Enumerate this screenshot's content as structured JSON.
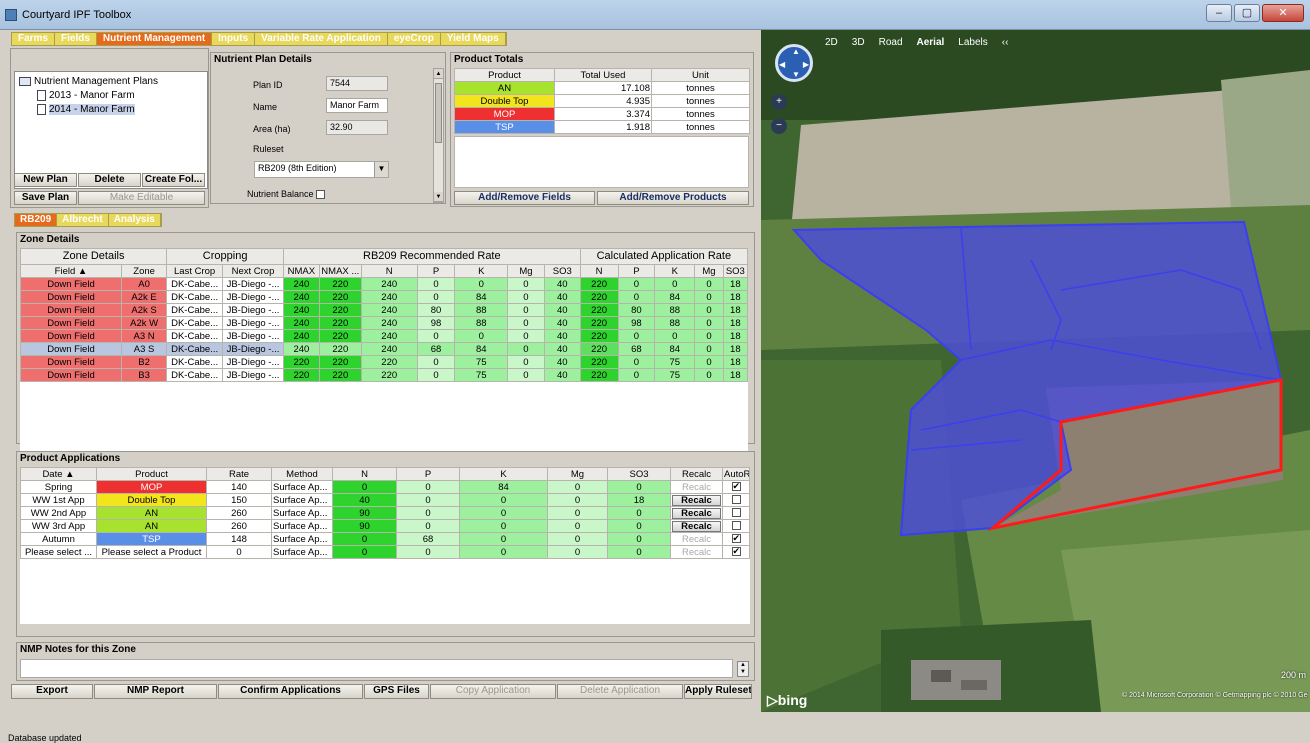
{
  "window": {
    "title": "Courtyard IPF Toolbox",
    "min": "–",
    "max": "▢",
    "close": "✕"
  },
  "main_tabs": [
    "Farms",
    "Fields",
    "Nutrient Management",
    "Inputs",
    "Variable Rate Application",
    "eyeCrop",
    "Yield Maps"
  ],
  "main_tab_active": 2,
  "tree": {
    "root": "Nutrient Management Plans",
    "items": [
      "2013 - Manor Farm",
      "2014 - Manor Farm"
    ]
  },
  "plan_buttons": {
    "new": "New Plan",
    "delete": "Delete",
    "create": "Create Fol...",
    "save": "Save Plan",
    "editable": "Make Editable"
  },
  "plan_details": {
    "title": "Nutrient Plan Details",
    "plan_id_label": "Plan ID",
    "plan_id": "7544",
    "name_label": "Name",
    "name": "Manor Farm",
    "area_label": "Area (ha)",
    "area": "32.90",
    "ruleset_label": "Ruleset",
    "ruleset": "RB209 (8th Edition)",
    "balance_label": "Nutrient Balance"
  },
  "product_totals": {
    "title": "Product Totals",
    "headers": [
      "Product",
      "Total Used",
      "Unit"
    ],
    "rows": [
      {
        "product": "AN",
        "total": "17.108",
        "unit": "tonnes",
        "color": "#a6e22e"
      },
      {
        "product": "Double Top",
        "total": "4.935",
        "unit": "tonnes",
        "color": "#f2e51c"
      },
      {
        "product": "MOP",
        "total": "3.374",
        "unit": "tonnes",
        "color": "#ee3030"
      },
      {
        "product": "TSP",
        "total": "1.918",
        "unit": "tonnes",
        "color": "#5a8fe8"
      }
    ],
    "add_fields": "Add/Remove Fields",
    "add_products": "Add/Remove Products"
  },
  "sub_tabs": [
    "RB209",
    "Albrecht",
    "Analysis"
  ],
  "zone_details": {
    "title": "Zone Details",
    "groups": [
      "Zone Details",
      "Cropping",
      "RB209 Recommended Rate",
      "Calculated Application Rate"
    ],
    "headers": [
      "Field ▲",
      "Zone",
      "Last Crop",
      "Next Crop",
      "NMAX",
      "NMAX ...",
      "N",
      "P",
      "K",
      "Mg",
      "SO3",
      "N",
      "P",
      "K",
      "Mg",
      "SO3"
    ],
    "rows": [
      {
        "c": [
          "Down Field",
          "A0",
          "DK-Cabe...",
          "JB-Diego -...",
          "240",
          "220",
          "240",
          "0",
          "0",
          "0",
          "40",
          "220",
          "0",
          "0",
          "0",
          "18"
        ],
        "sel": false
      },
      {
        "c": [
          "Down Field",
          "A2k E",
          "DK-Cabe...",
          "JB-Diego -...",
          "240",
          "220",
          "240",
          "0",
          "84",
          "0",
          "40",
          "220",
          "0",
          "84",
          "0",
          "18"
        ],
        "sel": false
      },
      {
        "c": [
          "Down Field",
          "A2k S",
          "DK-Cabe...",
          "JB-Diego -...",
          "240",
          "220",
          "240",
          "80",
          "88",
          "0",
          "40",
          "220",
          "80",
          "88",
          "0",
          "18"
        ],
        "sel": false
      },
      {
        "c": [
          "Down Field",
          "A2k W",
          "DK-Cabe...",
          "JB-Diego -...",
          "240",
          "220",
          "240",
          "98",
          "88",
          "0",
          "40",
          "220",
          "98",
          "88",
          "0",
          "18"
        ],
        "sel": false
      },
      {
        "c": [
          "Down Field",
          "A3 N",
          "DK-Cabe...",
          "JB-Diego -...",
          "240",
          "220",
          "240",
          "0",
          "0",
          "0",
          "40",
          "220",
          "0",
          "0",
          "0",
          "18"
        ],
        "sel": false
      },
      {
        "c": [
          "Down Field",
          "A3 S",
          "DK-Cabe...",
          "JB-Diego -...",
          "240",
          "220",
          "240",
          "68",
          "84",
          "0",
          "40",
          "220",
          "68",
          "84",
          "0",
          "18"
        ],
        "sel": true
      },
      {
        "c": [
          "Down Field",
          "B2",
          "DK-Cabe...",
          "JB-Diego -...",
          "220",
          "220",
          "220",
          "0",
          "75",
          "0",
          "40",
          "220",
          "0",
          "75",
          "0",
          "18"
        ],
        "sel": false
      },
      {
        "c": [
          "Down Field",
          "B3",
          "DK-Cabe...",
          "JB-Diego -...",
          "220",
          "220",
          "220",
          "0",
          "75",
          "0",
          "40",
          "220",
          "0",
          "75",
          "0",
          "18"
        ],
        "sel": false
      }
    ]
  },
  "product_apps": {
    "title": "Product Applications",
    "headers": [
      "Date ▲",
      "Product",
      "Rate",
      "Method",
      "N",
      "P",
      "K",
      "Mg",
      "SO3",
      "Recalc",
      "AutoRecalc"
    ],
    "rows": [
      {
        "date": "Spring",
        "product": "MOP",
        "pcolor": "#ee3030",
        "rate": "140",
        "method": "Surface Ap...",
        "n": "0",
        "p": "0",
        "k": "84",
        "mg": "0",
        "so3": "0",
        "recalc": "Recalc",
        "active": false,
        "auto": "✔"
      },
      {
        "date": "WW 1st App",
        "product": "Double Top",
        "pcolor": "#f2e51c",
        "rate": "150",
        "method": "Surface Ap...",
        "n": "40",
        "p": "0",
        "k": "0",
        "mg": "0",
        "so3": "18",
        "recalc": "Recalc",
        "active": true,
        "auto": ""
      },
      {
        "date": "WW 2nd App",
        "product": "AN",
        "pcolor": "#a6e22e",
        "rate": "260",
        "method": "Surface Ap...",
        "n": "90",
        "p": "0",
        "k": "0",
        "mg": "0",
        "so3": "0",
        "recalc": "Recalc",
        "active": true,
        "auto": ""
      },
      {
        "date": "WW 3rd App",
        "product": "AN",
        "pcolor": "#a6e22e",
        "rate": "260",
        "method": "Surface Ap...",
        "n": "90",
        "p": "0",
        "k": "0",
        "mg": "0",
        "so3": "0",
        "recalc": "Recalc",
        "active": true,
        "auto": ""
      },
      {
        "date": "Autumn",
        "product": "TSP",
        "pcolor": "#5a8fe8",
        "rate": "148",
        "method": "Surface Ap...",
        "n": "0",
        "p": "68",
        "k": "0",
        "mg": "0",
        "so3": "0",
        "recalc": "Recalc",
        "active": false,
        "auto": "✔"
      },
      {
        "date": "Please select ...",
        "product": "Please select a Product",
        "pcolor": "#ffffff",
        "rate": "0",
        "method": "Surface Ap...",
        "n": "0",
        "p": "0",
        "k": "0",
        "mg": "0",
        "so3": "0",
        "recalc": "Recalc",
        "active": false,
        "auto": "✔"
      }
    ]
  },
  "notes": {
    "title": "NMP Notes for this Zone"
  },
  "bottom_buttons": [
    {
      "label": "Export",
      "enabled": true
    },
    {
      "label": "NMP Report",
      "enabled": true
    },
    {
      "label": "Confirm Applications",
      "enabled": true
    },
    {
      "label": "GPS Files",
      "enabled": true
    },
    {
      "label": "Copy Application",
      "enabled": false
    },
    {
      "label": "Delete Application",
      "enabled": false
    },
    {
      "label": "Apply Ruleset",
      "enabled": true
    }
  ],
  "status": "Database updated",
  "map": {
    "modes": [
      "2D",
      "3D",
      "Road",
      "Aerial",
      "Labels",
      "‹‹"
    ],
    "active_mode": "Aerial",
    "scale": "200 m",
    "copyright": "© 2014 Microsoft Corporation  © Getmapping plc  © 2010 GeoEye",
    "logo": "bing",
    "colors": {
      "zone_fill": "#4d4fd6",
      "zone_edge": "#3b3ff0",
      "selected": "#ff1a1a"
    }
  }
}
